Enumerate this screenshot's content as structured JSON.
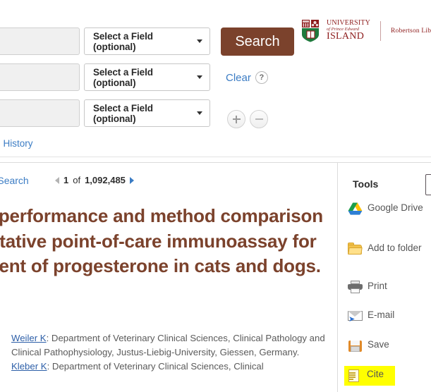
{
  "search_form": {
    "rows": [
      {
        "value": "",
        "placeholder": "",
        "field_label": "Select a Field (optional)"
      },
      {
        "value": "",
        "placeholder": "",
        "field_label": "Select a Field (optional)"
      },
      {
        "value": "",
        "placeholder": "",
        "field_label": "Select a Field (optional)"
      }
    ],
    "search_button": "Search",
    "clear_link": "Clear",
    "help_icon": "?",
    "add_row_icon": "plus-icon",
    "remove_row_icon": "minus-icon",
    "history_link": "Search History",
    "accent_color": "#7b422c",
    "link_color": "#3b7cc4"
  },
  "branding": {
    "university_line1": "UNIVERSITY",
    "university_line2": "of Prince Edward",
    "university_line3": "ISLAND",
    "library_name": "Robertson Library",
    "brand_color": "#8d1b1b"
  },
  "result": {
    "refine_link": "Refine Search",
    "pager": {
      "prev_icon": "triangle-left-icon",
      "next_icon": "triangle-right-icon",
      "current": "1",
      "of_label": "of",
      "total": "1,092,485"
    },
    "title": "Analytical performance and method comparison of a quantitative point-of-care immunoassay for measurement of progesterone in cats and dogs.",
    "title_color": "#7b422c",
    "authors": [
      {
        "name": "Weiler K",
        "affiliation": ": Department of Veterinary Clinical Sciences, Clinical Pathology and Clinical Pathophysiology, Justus-Liebig-University, Giessen, Germany."
      },
      {
        "name": "Kleber K",
        "affiliation": ": Department of Veterinary Clinical Sciences, Clinical"
      }
    ]
  },
  "tools": {
    "title": "Tools",
    "items": [
      {
        "label": "Google Drive",
        "icon": "google-drive-icon",
        "highlighted": false
      },
      {
        "label": "Add to folder",
        "icon": "folder-icon",
        "highlighted": false
      },
      {
        "label": "Print",
        "icon": "printer-icon",
        "highlighted": false
      },
      {
        "label": "E-mail",
        "icon": "envelope-icon",
        "highlighted": false
      },
      {
        "label": "Save",
        "icon": "floppy-disk-icon",
        "highlighted": false
      },
      {
        "label": "Cite",
        "icon": "document-icon",
        "highlighted": true
      }
    ],
    "highlight_color": "#ffff00"
  }
}
